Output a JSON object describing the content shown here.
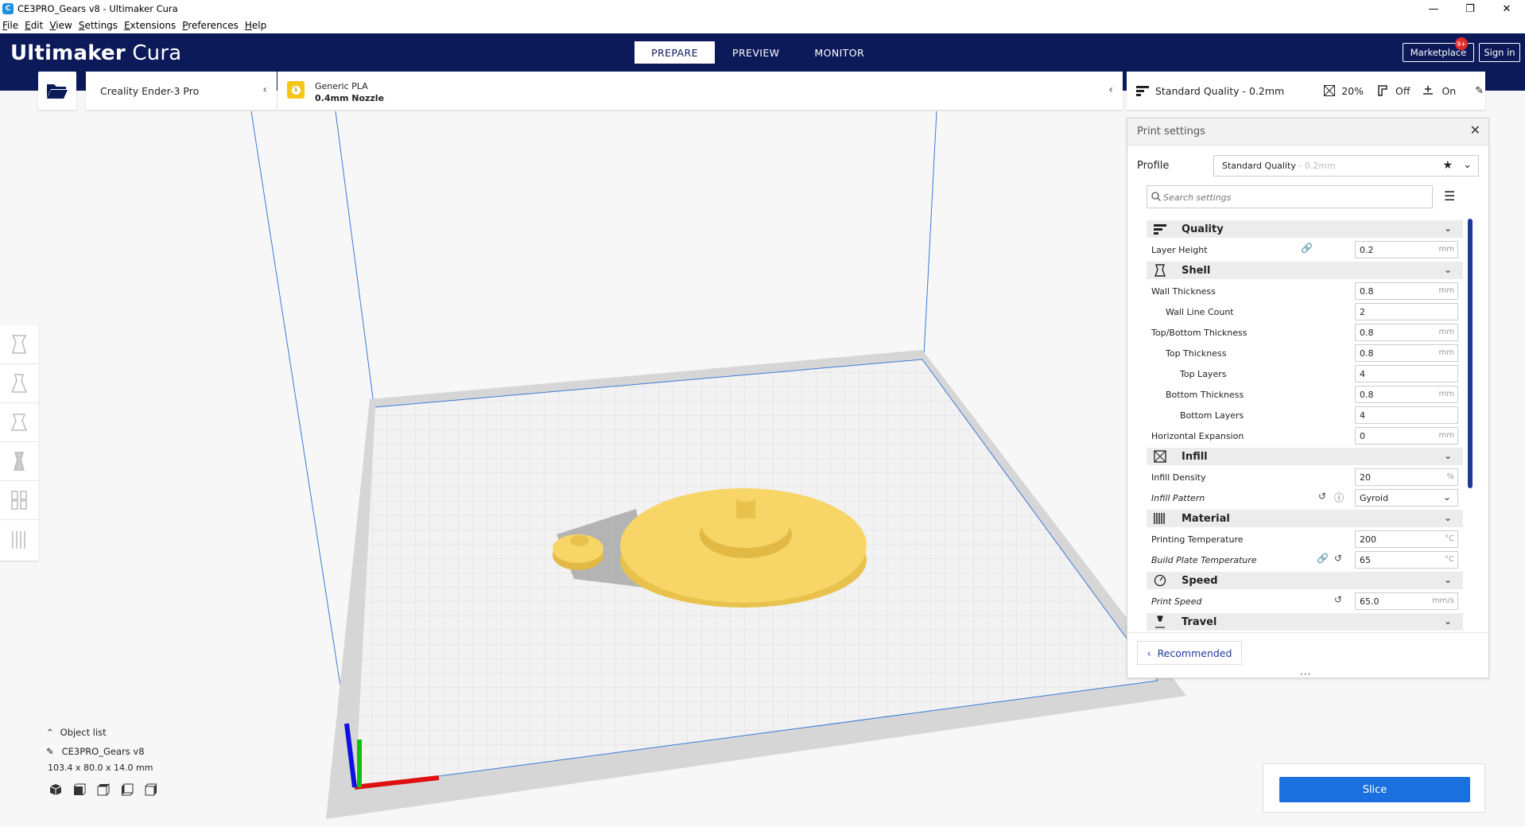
{
  "window": {
    "title": "CE3PRO_Gears v8 - Ultimaker Cura",
    "minimize": "—",
    "maximize": "❐",
    "close": "✕"
  },
  "menu": [
    "File",
    "Edit",
    "View",
    "Settings",
    "Extensions",
    "Preferences",
    "Help"
  ],
  "brand": {
    "bold": "Ultimaker",
    "light": "Cura"
  },
  "stages": [
    "PREPARE",
    "PREVIEW",
    "MONITOR"
  ],
  "active_stage": "PREPARE",
  "header_buttons": {
    "marketplace": "Marketplace",
    "marketplace_badge": "9+",
    "sign_in": "Sign in"
  },
  "machine": {
    "name": "Creality Ender-3 Pro"
  },
  "material": {
    "extruder": "1",
    "name": "Generic PLA",
    "nozzle": "0.4mm Nozzle"
  },
  "print_summary": {
    "profile": "Standard Quality - 0.2mm",
    "infill": "20%",
    "support": "Off",
    "adhesion": "On"
  },
  "print_settings": {
    "title": "Print settings",
    "profile_label": "Profile",
    "profile_value": "Standard Quality",
    "profile_suffix": " - 0.2mm",
    "search_placeholder": "Search settings",
    "categories": {
      "quality": "Quality",
      "shell": "Shell",
      "infill": "Infill",
      "material": "Material",
      "speed": "Speed",
      "travel": "Travel"
    },
    "rows": {
      "layer_height": {
        "label": "Layer Height",
        "value": "0.2",
        "unit": "mm"
      },
      "wall_thickness": {
        "label": "Wall Thickness",
        "value": "0.8",
        "unit": "mm"
      },
      "wall_line_count": {
        "label": "Wall Line Count",
        "value": "2"
      },
      "topbottom_thickness": {
        "label": "Top/Bottom Thickness",
        "value": "0.8",
        "unit": "mm"
      },
      "top_thickness": {
        "label": "Top Thickness",
        "value": "0.8",
        "unit": "mm"
      },
      "top_layers": {
        "label": "Top Layers",
        "value": "4"
      },
      "bottom_thickness": {
        "label": "Bottom Thickness",
        "value": "0.8",
        "unit": "mm"
      },
      "bottom_layers": {
        "label": "Bottom Layers",
        "value": "4"
      },
      "horizontal_expansion": {
        "label": "Horizontal Expansion",
        "value": "0",
        "unit": "mm"
      },
      "infill_density": {
        "label": "Infill Density",
        "value": "20",
        "unit": "%"
      },
      "infill_pattern": {
        "label": "Infill Pattern",
        "value": "Gyroid"
      },
      "printing_temperature": {
        "label": "Printing Temperature",
        "value": "200",
        "unit": "°C"
      },
      "build_plate_temperature": {
        "label": "Build Plate Temperature",
        "value": "65",
        "unit": "°C"
      },
      "print_speed": {
        "label": "Print Speed",
        "value": "65.0",
        "unit": "mm/s"
      }
    },
    "recommended_button": "Recommended"
  },
  "object_list": {
    "label": "Object list",
    "object_name": "CE3PRO_Gears v8",
    "dimensions": "103.4 x 80.0 x 14.0 mm"
  },
  "slice_button": "Slice",
  "colors": {
    "header": "#0c1a5a",
    "accent": "#1f3a9c",
    "slice": "#1b6fde",
    "model": "#f7d567",
    "x_axis": "#e01010",
    "y_axis": "#10c010",
    "z_axis": "#1010e0"
  }
}
